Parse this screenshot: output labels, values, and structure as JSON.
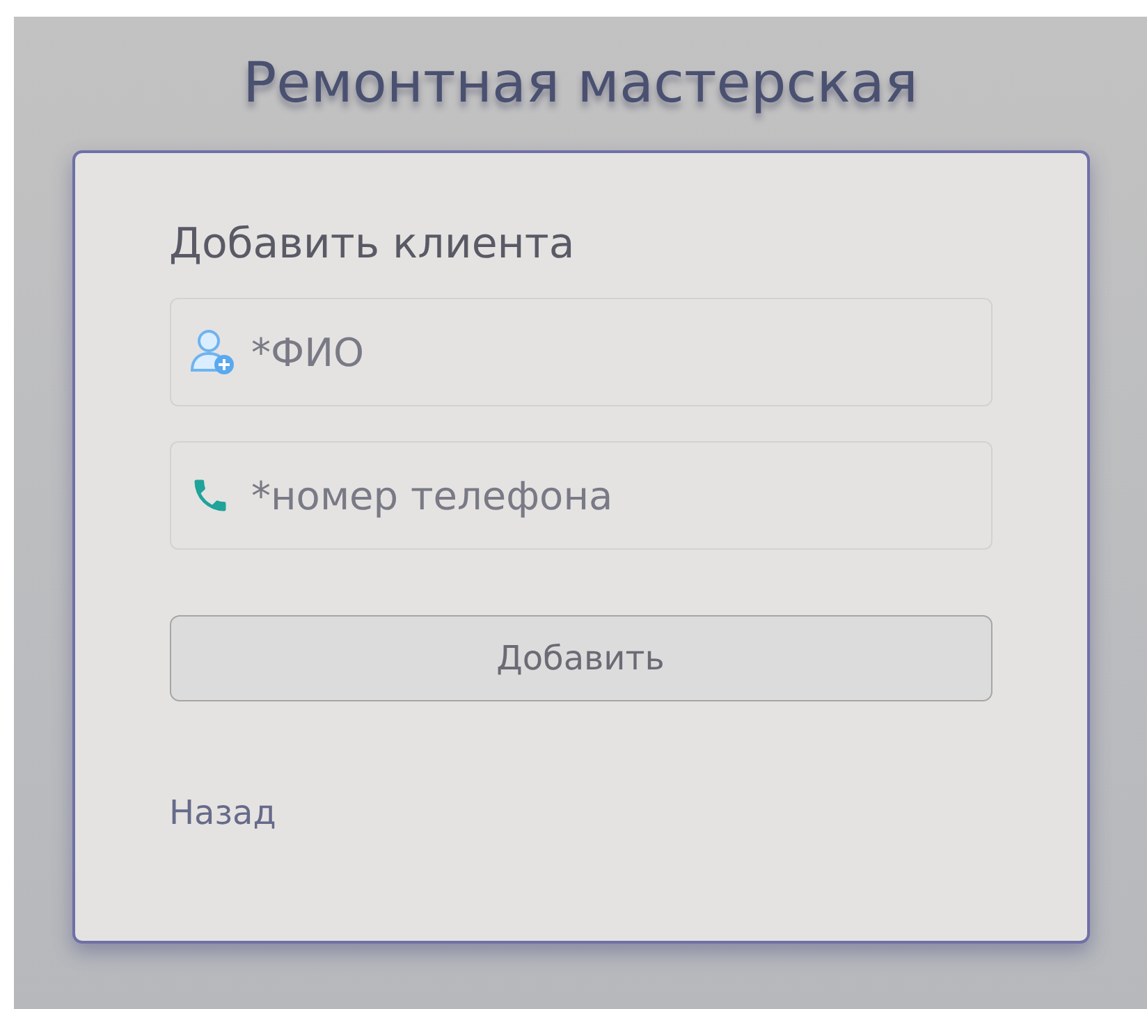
{
  "app_title": "Ремонтная мастерская",
  "form": {
    "heading": "Добавить клиента",
    "fields": [
      {
        "kind": "person",
        "placeholder": "*ФИО"
      },
      {
        "kind": "phone",
        "placeholder": "*номер телефона"
      }
    ],
    "submit": "Добавить",
    "back_link": "Назад"
  }
}
